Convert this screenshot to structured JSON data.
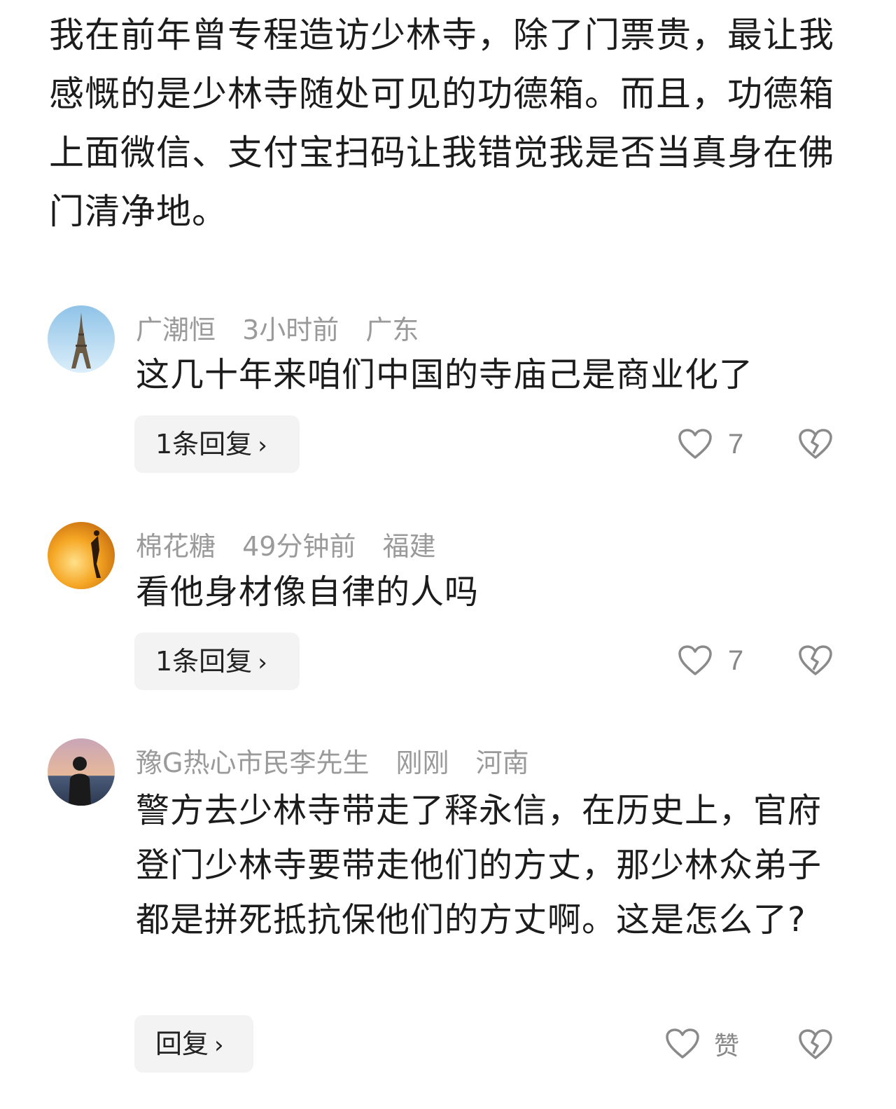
{
  "post": {
    "text": "我在前年曾专程造访少林寺，除了门票贵，最让我感慨的是少林寺随处可见的功德箱。而且，功德箱上面微信、支付宝扫码让我错觉我是否当真身在佛门清净地。"
  },
  "comments": [
    {
      "username": "广潮恒",
      "time": "3小时前",
      "location": "广东",
      "text": "这几十年来咱们中国的寺庙己是商业化了",
      "reply_label": "1条回复",
      "like_count": "7",
      "avatar_icon": "eiffel-tower-avatar"
    },
    {
      "username": "棉花糖",
      "time": "49分钟前",
      "location": "福建",
      "text": "看他身材像自律的人吗",
      "reply_label": "1条回复",
      "like_count": "7",
      "avatar_icon": "sunset-dancer-avatar"
    },
    {
      "username": "豫G热心市民李先生",
      "time": "刚刚",
      "location": "河南",
      "text": "警方去少林寺带走了释永信，在历史上，官府登门少林寺要带走他们的方丈，那少林众弟子都是拼死抵抗保他们的方丈啊。这是怎么了?",
      "reply_label": "回复",
      "like_count": "赞",
      "avatar_icon": "person-at-sea-avatar"
    }
  ],
  "icons": {
    "reply_chevron": "›",
    "like": "heart-outline-icon",
    "dislike": "broken-heart-icon"
  },
  "colors": {
    "meta_gray": "#9a9a9a",
    "reply_bg": "#f3f3f3",
    "text": "#1c1c1c"
  }
}
